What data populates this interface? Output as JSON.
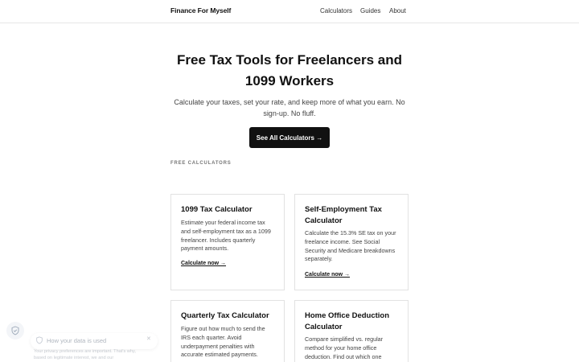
{
  "header": {
    "brand": "Finance For Myself",
    "nav": [
      "Calculators",
      "Guides",
      "About"
    ]
  },
  "hero": {
    "title": "Free Tax Tools for Freelancers and 1099 Workers",
    "subtitle": "Calculate your taxes, set your rate, and keep more of what you earn. No sign-up. No fluff.",
    "cta_label": "See All Calculators →"
  },
  "section_label": "FREE CALCULATORS",
  "cards": [
    {
      "title": "1099 Tax Calculator",
      "description": "Estimate your federal income tax and self-employment tax as a 1099 freelancer. Includes quarterly payment amounts.",
      "link": "Calculate now →"
    },
    {
      "title": "Self-Employment Tax Calculator",
      "description": "Calculate the 15.3% SE tax on your freelance income. See Social Security and Medicare breakdowns separately.",
      "link": "Calculate now →"
    },
    {
      "title": "Quarterly Tax Calculator",
      "description": "Figure out how much to send the IRS each quarter. Avoid underpayment penalties with accurate estimated payments.",
      "link": ""
    },
    {
      "title": "Home Office Deduction Calculator",
      "description": "Compare simplified vs. regular method for your home office deduction. Find out which one saves",
      "link": ""
    }
  ],
  "consent": {
    "title": "How your data is used",
    "text": "Your privacy preferences are important. That's why, based on legitimate interest, we and our",
    "close_icon": "close-icon",
    "shield_icon": "shield-icon"
  }
}
